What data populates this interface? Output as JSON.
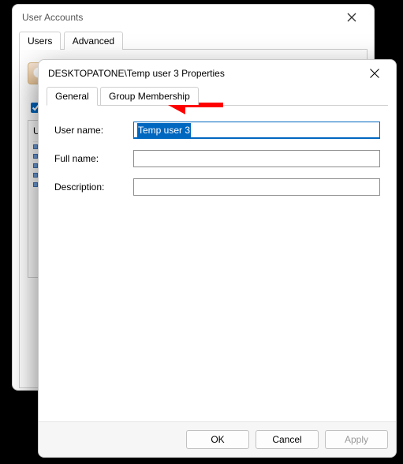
{
  "parent_window": {
    "title": "User Accounts",
    "tabs": [
      "Users",
      "Advanced"
    ],
    "users_label": "Us",
    "col_header": "U"
  },
  "dialog": {
    "title": "DESKTOPATONE\\Temp user 3 Properties",
    "tabs": {
      "general": "General",
      "group_membership": "Group Membership"
    },
    "fields": {
      "username_label": "User name:",
      "username_value": "Temp user 3",
      "fullname_label": "Full name:",
      "fullname_value": "",
      "description_label": "Description:",
      "description_value": ""
    },
    "buttons": {
      "ok": "OK",
      "cancel": "Cancel",
      "apply": "Apply"
    }
  }
}
